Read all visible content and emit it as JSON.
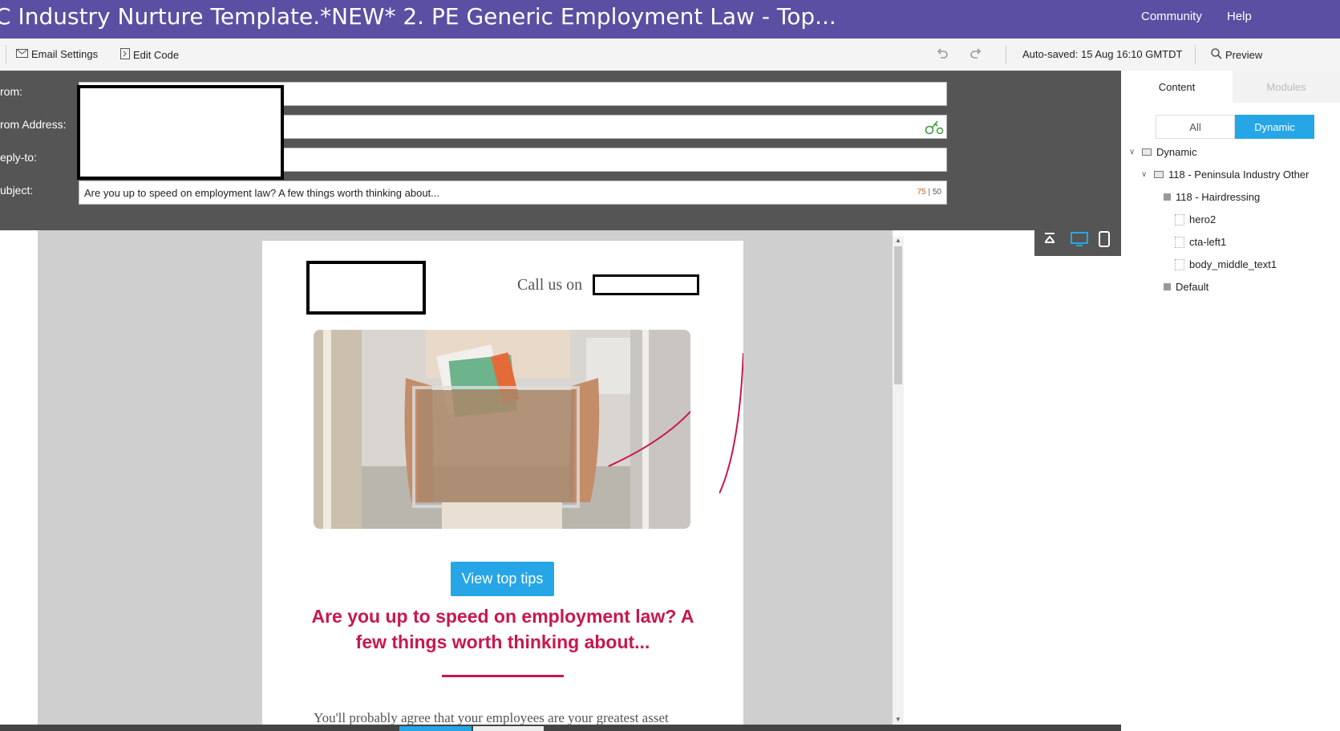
{
  "titlebar": {
    "title": "C Industry Nurture Template.*NEW* 2. PE Generic Employment Law - Top...",
    "nav_community": "Community",
    "nav_help": "Help"
  },
  "toolbar": {
    "email_settings": "Email Settings",
    "edit_code": "Edit Code",
    "autosaved": "Auto-saved: 15 Aug 16:10 GMTDT",
    "preview": "Preview"
  },
  "headers": {
    "from_label": "rom:",
    "from_address_label": "rom Address:",
    "reply_to_label": "eply-to:",
    "subject_label": "ubject:",
    "subject_value": "Are you up to speed on employment law? A few things worth thinking about...",
    "subject_count": "75",
    "subject_limit": "50"
  },
  "email": {
    "call_us": "Call us on",
    "button_label": "View top tips",
    "headline": "Are you up to speed on employment law? A few things worth thinking about...",
    "body_text": "You'll probably agree that your employees are your greatest asset"
  },
  "sidebar": {
    "tab_content": "Content",
    "tab_modules": "Modules",
    "filter_all": "All",
    "filter_dynamic": "Dynamic",
    "tree": {
      "root": "Dynamic",
      "group": "118 - Peninsula Industry Other",
      "segment": "118 - Hairdressing",
      "item1": "hero2",
      "item2": "cta-left1",
      "item3": "body_middle_text1",
      "default": "Default"
    }
  },
  "colors": {
    "brand_purple": "#5a4fa2",
    "accent_blue": "#26a6e6",
    "headline_red": "#c8174e",
    "header_bg": "#555555"
  }
}
